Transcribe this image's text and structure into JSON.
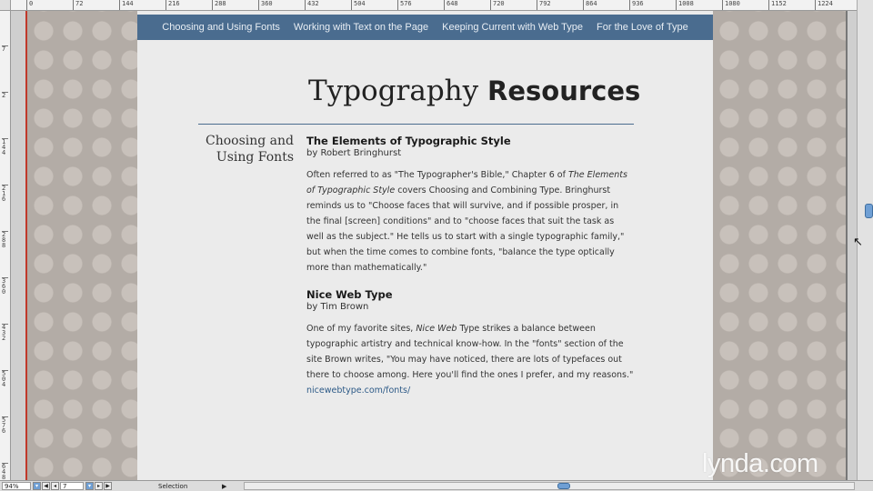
{
  "ruler": {
    "top_ticks": [
      "0",
      "72",
      "144",
      "216",
      "288",
      "360",
      "432",
      "504",
      "576",
      "648",
      "720",
      "792",
      "864",
      "936",
      "1008",
      "1080",
      "1152",
      "1224"
    ],
    "left_ticks": [
      "7",
      "2",
      "144",
      "216",
      "288",
      "360",
      "432",
      "504",
      "576",
      "648"
    ]
  },
  "nav": {
    "items": [
      "Choosing and Using Fonts",
      "Working with Text on the Page",
      "Keeping Current with Web Type",
      "For the Love of Type"
    ]
  },
  "title": {
    "regular": "Typography",
    "bold": "Resources"
  },
  "section": {
    "line1": "Choosing and",
    "line2": "Using Fonts"
  },
  "entries": [
    {
      "title": "The Elements of Typographic Style",
      "author": "by Robert Bringhurst",
      "body_pre": "Often referred to as \"The Typographer's Bible,\" Chapter 6 of ",
      "body_italic": "The Elements of Typographic Style",
      "body_post": " covers Choosing and Combining Type. Bringhurst reminds us to \"Choose faces that will survive, and if possible prosper, in the final [screen] conditions\" and to \"choose faces that suit the task as well as the subject.\" He tells us to start with a single typographic family,\" but when the time comes to combine fonts, \"balance the type optically more than mathematically.\""
    },
    {
      "title": "Nice Web Type",
      "author": "by Tim Brown",
      "body_pre": "One of my favorite sites, ",
      "body_italic": "Nice Web",
      "body_post": " Type strikes a balance between typographic artistry and technical know-how. In the \"fonts\" section of the site Brown writes, \"You may have noticed, there are lots of typefaces out there to choose among. Here you'll find the ones I prefer, and my reasons.\"",
      "link": "nicewebtype.com/fonts/"
    }
  ],
  "statusbar": {
    "zoom": "94%",
    "page": "7",
    "tool": "Selection"
  },
  "watermark": "lynda.com",
  "colors": {
    "nav_bg": "#4a6c8f",
    "link": "#2d5a87",
    "dots_bg": "#b3aca6",
    "content_bg": "#ebebeb"
  }
}
